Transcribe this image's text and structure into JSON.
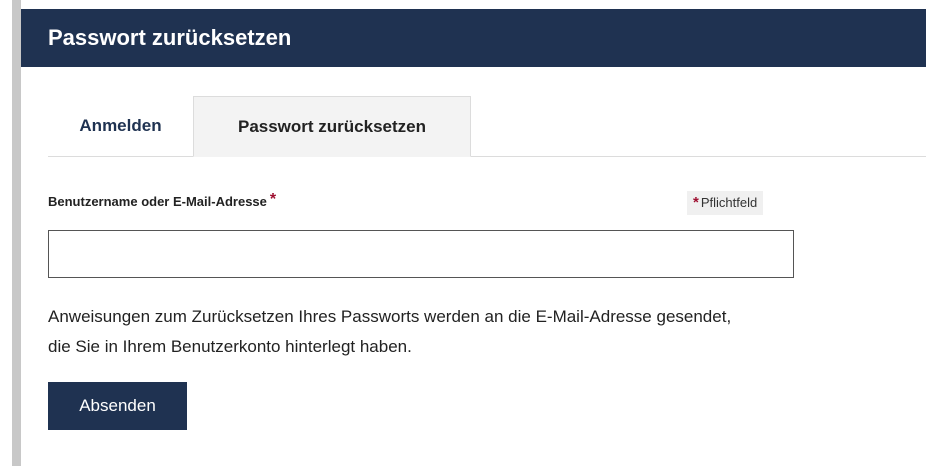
{
  "header": {
    "title": "Passwort zurücksetzen"
  },
  "tabs": [
    {
      "label": "Anmelden",
      "active": false
    },
    {
      "label": "Passwort zurücksetzen",
      "active": true
    }
  ],
  "form": {
    "username_label": "Benutzername oder E-Mail-Adresse",
    "required_marker": "*",
    "required_note": "Pflichtfeld",
    "username_value": "",
    "username_placeholder": "",
    "instructions": "Anweisungen zum Zurücksetzen Ihres Passworts werden an die E-Mail-Adresse gesendet, die Sie in Ihrem Benutzerkonto hinterlegt haben.",
    "submit_label": "Absenden"
  },
  "colors": {
    "header_bg": "#1f3251",
    "button_bg": "#1f3251",
    "required_marker": "#9e0e2f",
    "active_tab_bg": "#f3f3f3"
  }
}
